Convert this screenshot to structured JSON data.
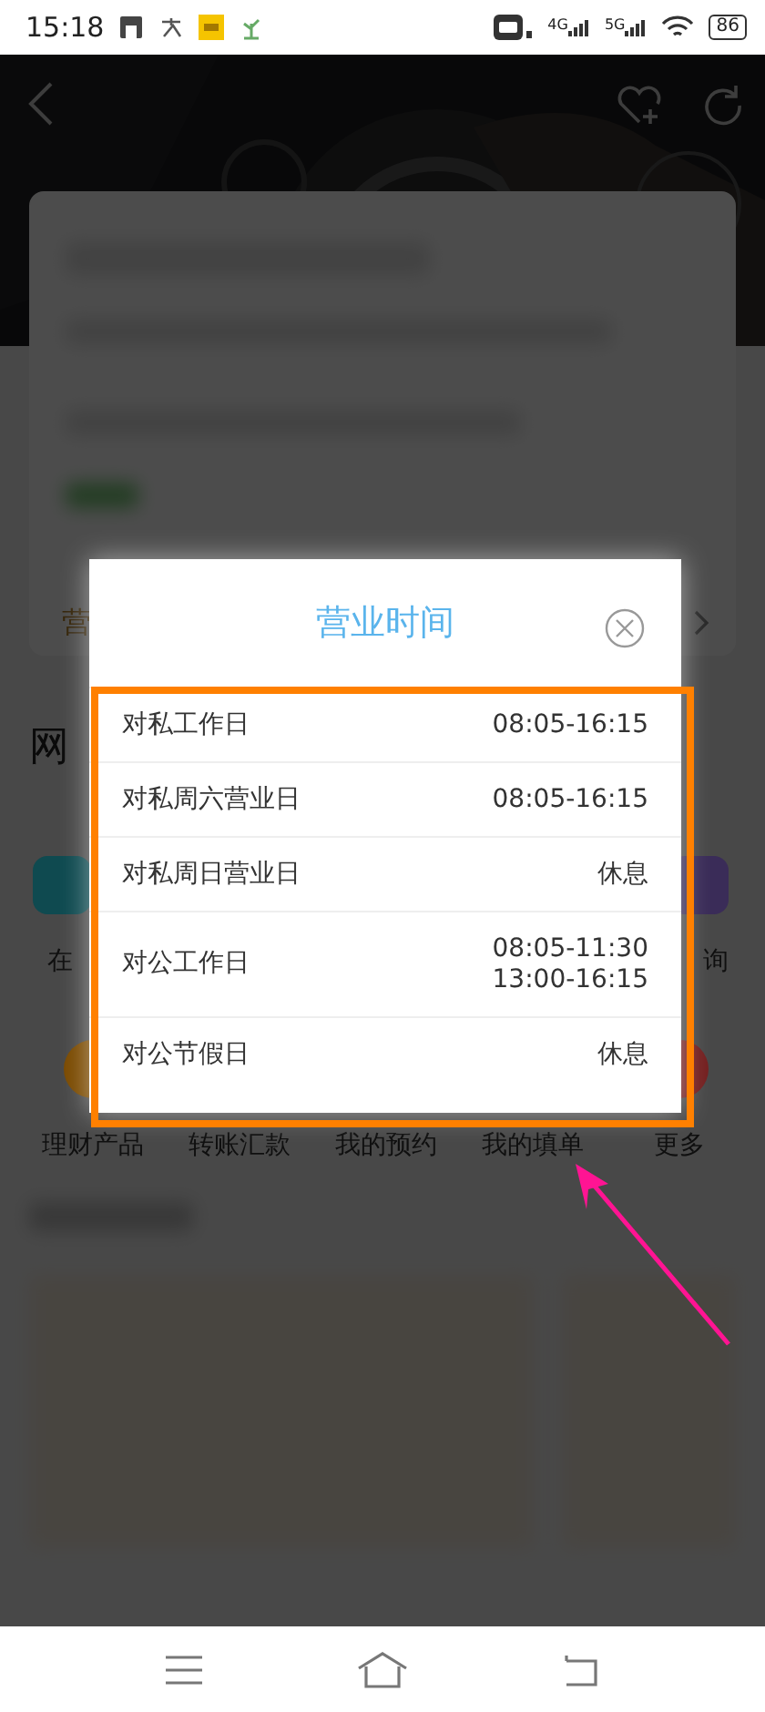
{
  "status_bar": {
    "time": "15:18",
    "network_labels": [
      "4G",
      "5G"
    ],
    "battery": "86"
  },
  "page": {
    "promo_text": "营",
    "section_title": "网",
    "shortcuts_row_1": [
      {
        "label": "在",
        "color": "#0f4a50"
      },
      {
        "label": "询",
        "color": "#3a2c58"
      }
    ],
    "shortcuts_row_2": [
      {
        "label": "理财产品",
        "color": "#7a4a00"
      },
      {
        "label": "转账汇款"
      },
      {
        "label": "我的预约"
      },
      {
        "label": "我的填单"
      },
      {
        "label": "更多",
        "color": "#742020"
      }
    ]
  },
  "dialog": {
    "title": "营业时间",
    "rows": [
      {
        "label": "对私工作日",
        "hours": [
          "08:05-16:15"
        ]
      },
      {
        "label": "对私周六营业日",
        "hours": [
          "08:05-16:15"
        ]
      },
      {
        "label": "对私周日营业日",
        "hours": [
          "休息"
        ]
      },
      {
        "label": "对公工作日",
        "hours": [
          "08:05-11:30",
          "13:00-16:15"
        ]
      },
      {
        "label": "对公节假日",
        "hours": [
          "休息"
        ]
      }
    ]
  }
}
